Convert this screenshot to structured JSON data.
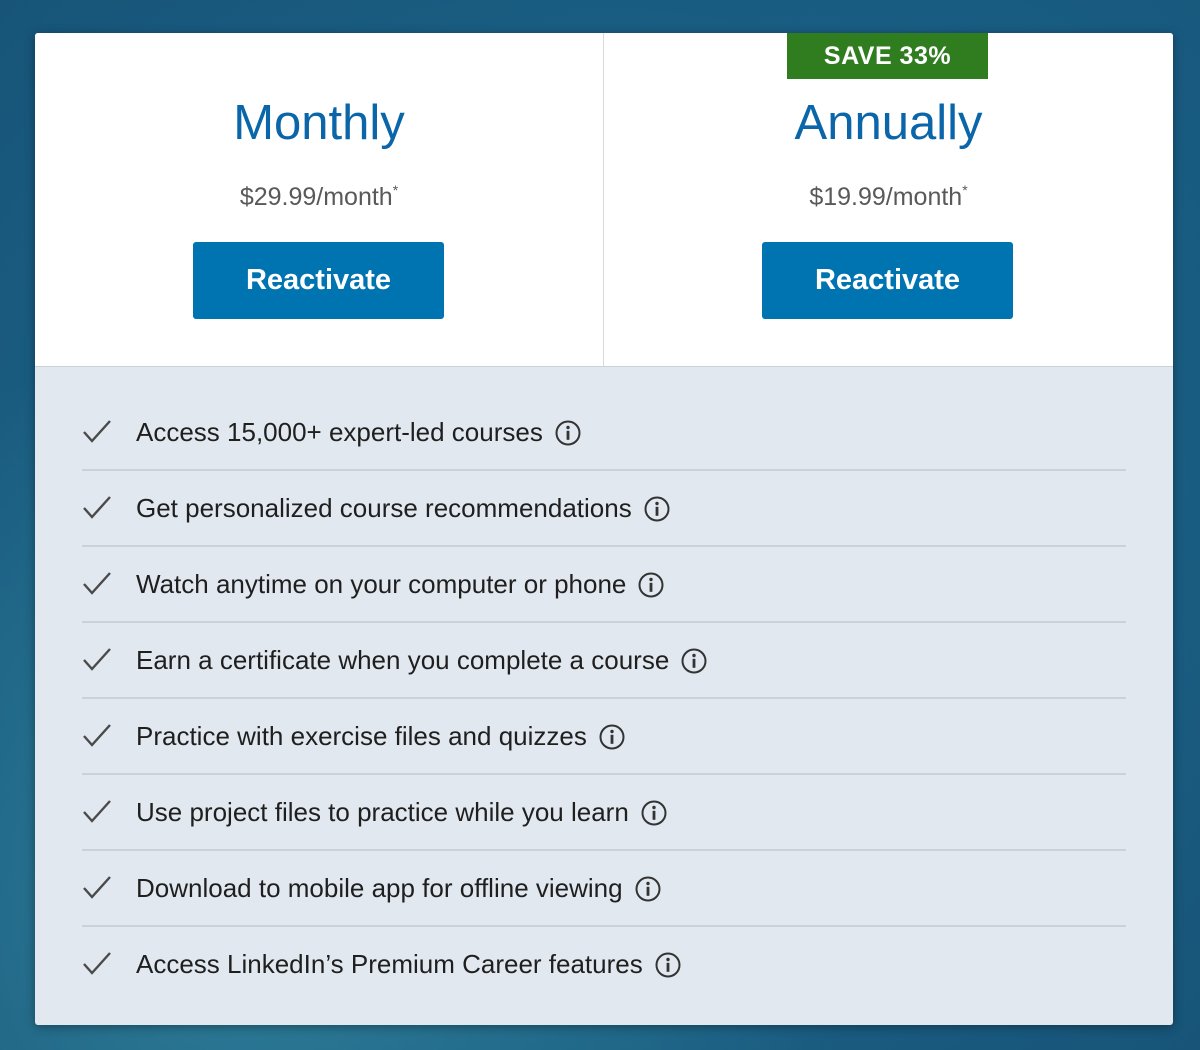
{
  "plans": [
    {
      "title": "Monthly",
      "price": "$29.99/month",
      "price_note": "*",
      "button_label": "Reactivate"
    },
    {
      "badge": "SAVE 33%",
      "title": "Annually",
      "price": "$19.99/month",
      "price_note": "*",
      "button_label": "Reactivate"
    }
  ],
  "features": [
    "Access 15,000+ expert-led courses",
    "Get personalized course recommendations",
    "Watch anytime on your computer or phone",
    "Earn a certificate when you complete a course",
    "Practice with exercise files and quizzes",
    "Use project files to practice while you learn",
    "Download to mobile app for offline viewing",
    "Access LinkedIn’s Premium Career features"
  ],
  "icons": {
    "feature_check": "check-icon",
    "feature_info": "info-icon"
  },
  "colors": {
    "accent": "#0073b1",
    "title": "#0a66a8",
    "badge": "#2f7d1f",
    "features_background": "#e1e8ef"
  }
}
